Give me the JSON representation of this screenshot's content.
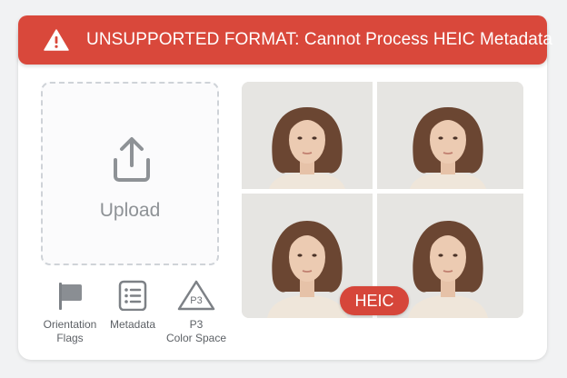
{
  "banner": {
    "message": "UNSUPPORTED FORMAT: Cannot Process HEIC Metadata",
    "icon": "warning-icon",
    "color": "#d9483b"
  },
  "upload": {
    "label": "Upload",
    "icon": "upload-icon"
  },
  "metadata_items": [
    {
      "label_line1": "Orientation",
      "label_line2": "Flags",
      "icon": "flag-icon"
    },
    {
      "label_line1": "Metadata",
      "label_line2": "",
      "icon": "list-document-icon"
    },
    {
      "label_line1": "P3",
      "label_line2": "Color Space",
      "icon": "p3-triangle-icon"
    }
  ],
  "p3_icon_text": "P3",
  "preview": {
    "badge": "HEIC",
    "badge_color": "#d6463a",
    "tiles": [
      {
        "name": "portrait-1"
      },
      {
        "name": "portrait-2"
      },
      {
        "name": "portrait-3"
      },
      {
        "name": "portrait-4"
      }
    ]
  }
}
